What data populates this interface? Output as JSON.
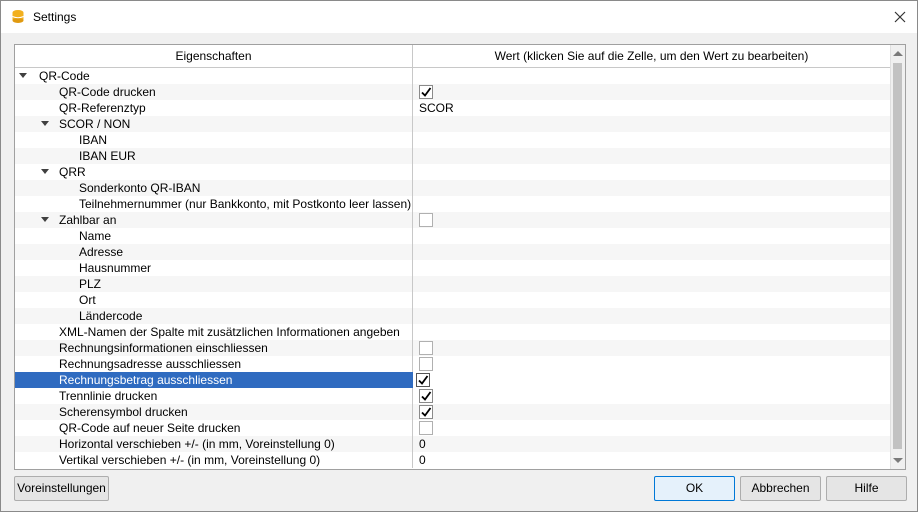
{
  "window": {
    "title": "Settings"
  },
  "grid": {
    "headers": [
      "Eigenschaften",
      "Wert (klicken Sie auf die Zelle, um den Wert zu bearbeiten)"
    ],
    "rows": [
      {
        "label": "QR-Code",
        "level": 0,
        "expander": true,
        "value_type": "none",
        "value": ""
      },
      {
        "label": "QR-Code drucken",
        "level": 2,
        "expander": false,
        "value_type": "checkbox",
        "checked": true
      },
      {
        "label": "QR-Referenztyp",
        "level": 2,
        "expander": false,
        "value_type": "text",
        "value": "SCOR"
      },
      {
        "label": "SCOR / NON",
        "level": 1,
        "expander": true,
        "value_type": "none",
        "value": ""
      },
      {
        "label": "IBAN",
        "level": 3,
        "expander": false,
        "value_type": "none",
        "value": ""
      },
      {
        "label": "IBAN EUR",
        "level": 3,
        "expander": false,
        "value_type": "none",
        "value": ""
      },
      {
        "label": "QRR",
        "level": 1,
        "expander": true,
        "value_type": "none",
        "value": ""
      },
      {
        "label": "Sonderkonto QR-IBAN",
        "level": 3,
        "expander": false,
        "value_type": "none",
        "value": ""
      },
      {
        "label": "Teilnehmernummer (nur Bankkonto, mit Postkonto leer lassen)",
        "level": 3,
        "expander": false,
        "value_type": "none",
        "value": ""
      },
      {
        "label": "Zahlbar an",
        "level": 1,
        "expander": true,
        "value_type": "checkbox",
        "checked": false
      },
      {
        "label": "Name",
        "level": 3,
        "expander": false,
        "value_type": "none",
        "value": ""
      },
      {
        "label": "Adresse",
        "level": 3,
        "expander": false,
        "value_type": "none",
        "value": ""
      },
      {
        "label": "Hausnummer",
        "level": 3,
        "expander": false,
        "value_type": "none",
        "value": ""
      },
      {
        "label": "PLZ",
        "level": 3,
        "expander": false,
        "value_type": "none",
        "value": ""
      },
      {
        "label": "Ort",
        "level": 3,
        "expander": false,
        "value_type": "none",
        "value": ""
      },
      {
        "label": "Ländercode",
        "level": 3,
        "expander": false,
        "value_type": "none",
        "value": ""
      },
      {
        "label": "XML-Namen der Spalte mit zusätzlichen Informationen angeben",
        "level": 2,
        "expander": false,
        "value_type": "none",
        "value": ""
      },
      {
        "label": "Rechnungsinformationen einschliessen",
        "level": 2,
        "expander": false,
        "value_type": "checkbox",
        "checked": false
      },
      {
        "label": "Rechnungsadresse ausschliessen",
        "level": 2,
        "expander": false,
        "value_type": "checkbox",
        "checked": false
      },
      {
        "label": "Rechnungsbetrag ausschliessen",
        "level": 2,
        "expander": false,
        "value_type": "checkbox",
        "checked": true,
        "selected": true
      },
      {
        "label": "Trennlinie drucken",
        "level": 2,
        "expander": false,
        "value_type": "checkbox",
        "checked": true
      },
      {
        "label": "Scherensymbol drucken",
        "level": 2,
        "expander": false,
        "value_type": "checkbox",
        "checked": true
      },
      {
        "label": "QR-Code auf neuer Seite drucken",
        "level": 2,
        "expander": false,
        "value_type": "checkbox",
        "checked": false
      },
      {
        "label": "Horizontal verschieben +/- (in mm, Voreinstellung 0)",
        "level": 2,
        "expander": false,
        "value_type": "text",
        "value": "0"
      },
      {
        "label": "Vertikal verschieben +/- (in mm, Voreinstellung 0)",
        "level": 2,
        "expander": false,
        "value_type": "text",
        "value": "0"
      }
    ]
  },
  "buttons": {
    "defaults": "Voreinstellungen",
    "ok": "OK",
    "cancel": "Abbrechen",
    "help": "Hilfe"
  },
  "colors": {
    "selection": "#2f6bc0",
    "app_icon": "#f2b01e"
  }
}
